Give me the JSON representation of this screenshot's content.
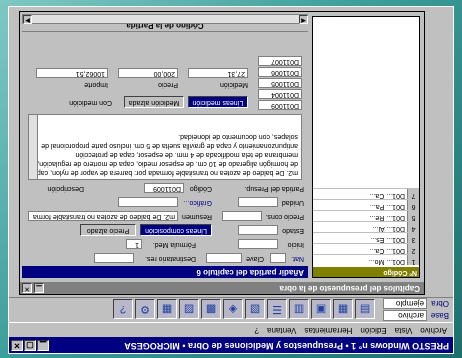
{
  "app": {
    "title": "PRESTO Windows n° 1 • Presupuestos y Mediciones de Obra • MICROGESA",
    "menu": [
      "Archivo",
      "Vista",
      "Edición",
      "Herramientas",
      "Ventana",
      "?"
    ],
    "base_label": "Base",
    "base_value": "archivo",
    "obra_label": "Obra",
    "obra_value": "ejemplo"
  },
  "doc": {
    "window_title": "Capítulos del presupuesto de la obra",
    "form_title": "Añadir partida del capítulo 6"
  },
  "grid": {
    "header": "Nº Código",
    "rows": [
      {
        "n": "1",
        "code": "D01...",
        "text": "Mo..."
      },
      {
        "n": "2",
        "code": "D01...",
        "text": "Ca..."
      },
      {
        "n": "3",
        "code": "D01...",
        "text": "Es..."
      },
      {
        "n": "4",
        "code": "D01...",
        "text": "Al..."
      },
      {
        "n": "5",
        "code": "D01...",
        "text": "Re..."
      },
      {
        "n": "6",
        "code": "D01...",
        "text": "Pa..."
      },
      {
        "n": "7",
        "code": "D01...",
        "text": "Ca..."
      }
    ]
  },
  "form": {
    "fields": {
      "nat_lbl": "Nat.",
      "clave_lbl": "Clave",
      "destinatario_lbl": "Destinatario res.",
      "inicio_lbl": "Inicio",
      "formula_lbl": "Fórmula Med.",
      "formula_val": "1",
      "estado_lbl": "Estado",
      "precio_cons_lbl": "Precio cons.",
      "lineas_btn": "Líneas composición",
      "precio_btn": "Precio alzado",
      "unidad_lbl": "Unidad",
      "fraccion_lbl": "Fracción cons.",
      "resumen_lbl": "Resumen",
      "resumen_val": "m2. De baldeo de azotea no transitable forma",
      "grafico_lbl": "Gráfico...",
      "partida_lbl": "Partida del Presup.",
      "codigo_lbl": "Código",
      "codigo_val": "D011009",
      "descripcion_lbl": "Descripción"
    },
    "description": "m2. De baldeo de azotea no transitable formada por: barrera de vapor de nylon, capa de hormigón aligerado de 10 cm. de espesor medio, capa de mortero de regulación, membrana de tela modificada de 4 mm. de espesor, capa de protección antipunzonamiento y capa de gravilla suelta de 5 cm. incluso parte proporcional de solapes, con documento de idoneidad.",
    "list_codes": [
      "D011009",
      "D011004",
      "D011005",
      "D011006",
      "D011007",
      "D011008",
      "D011008",
      "D011010",
      "D011035",
      "D011046"
    ],
    "lineas_med_btn": "Líneas medición",
    "medicion_alzada_btn": "Medición alzada",
    "con_medicion_lbl": "Con medición",
    "medicion_lbl": "Medición",
    "medicion_val": "27,31",
    "precio_lbl": "Precio",
    "precio_val": "200,00",
    "importe_lbl": "Importe",
    "importe_val": "10062,51",
    "bottom_title": "Código de la Partida"
  }
}
